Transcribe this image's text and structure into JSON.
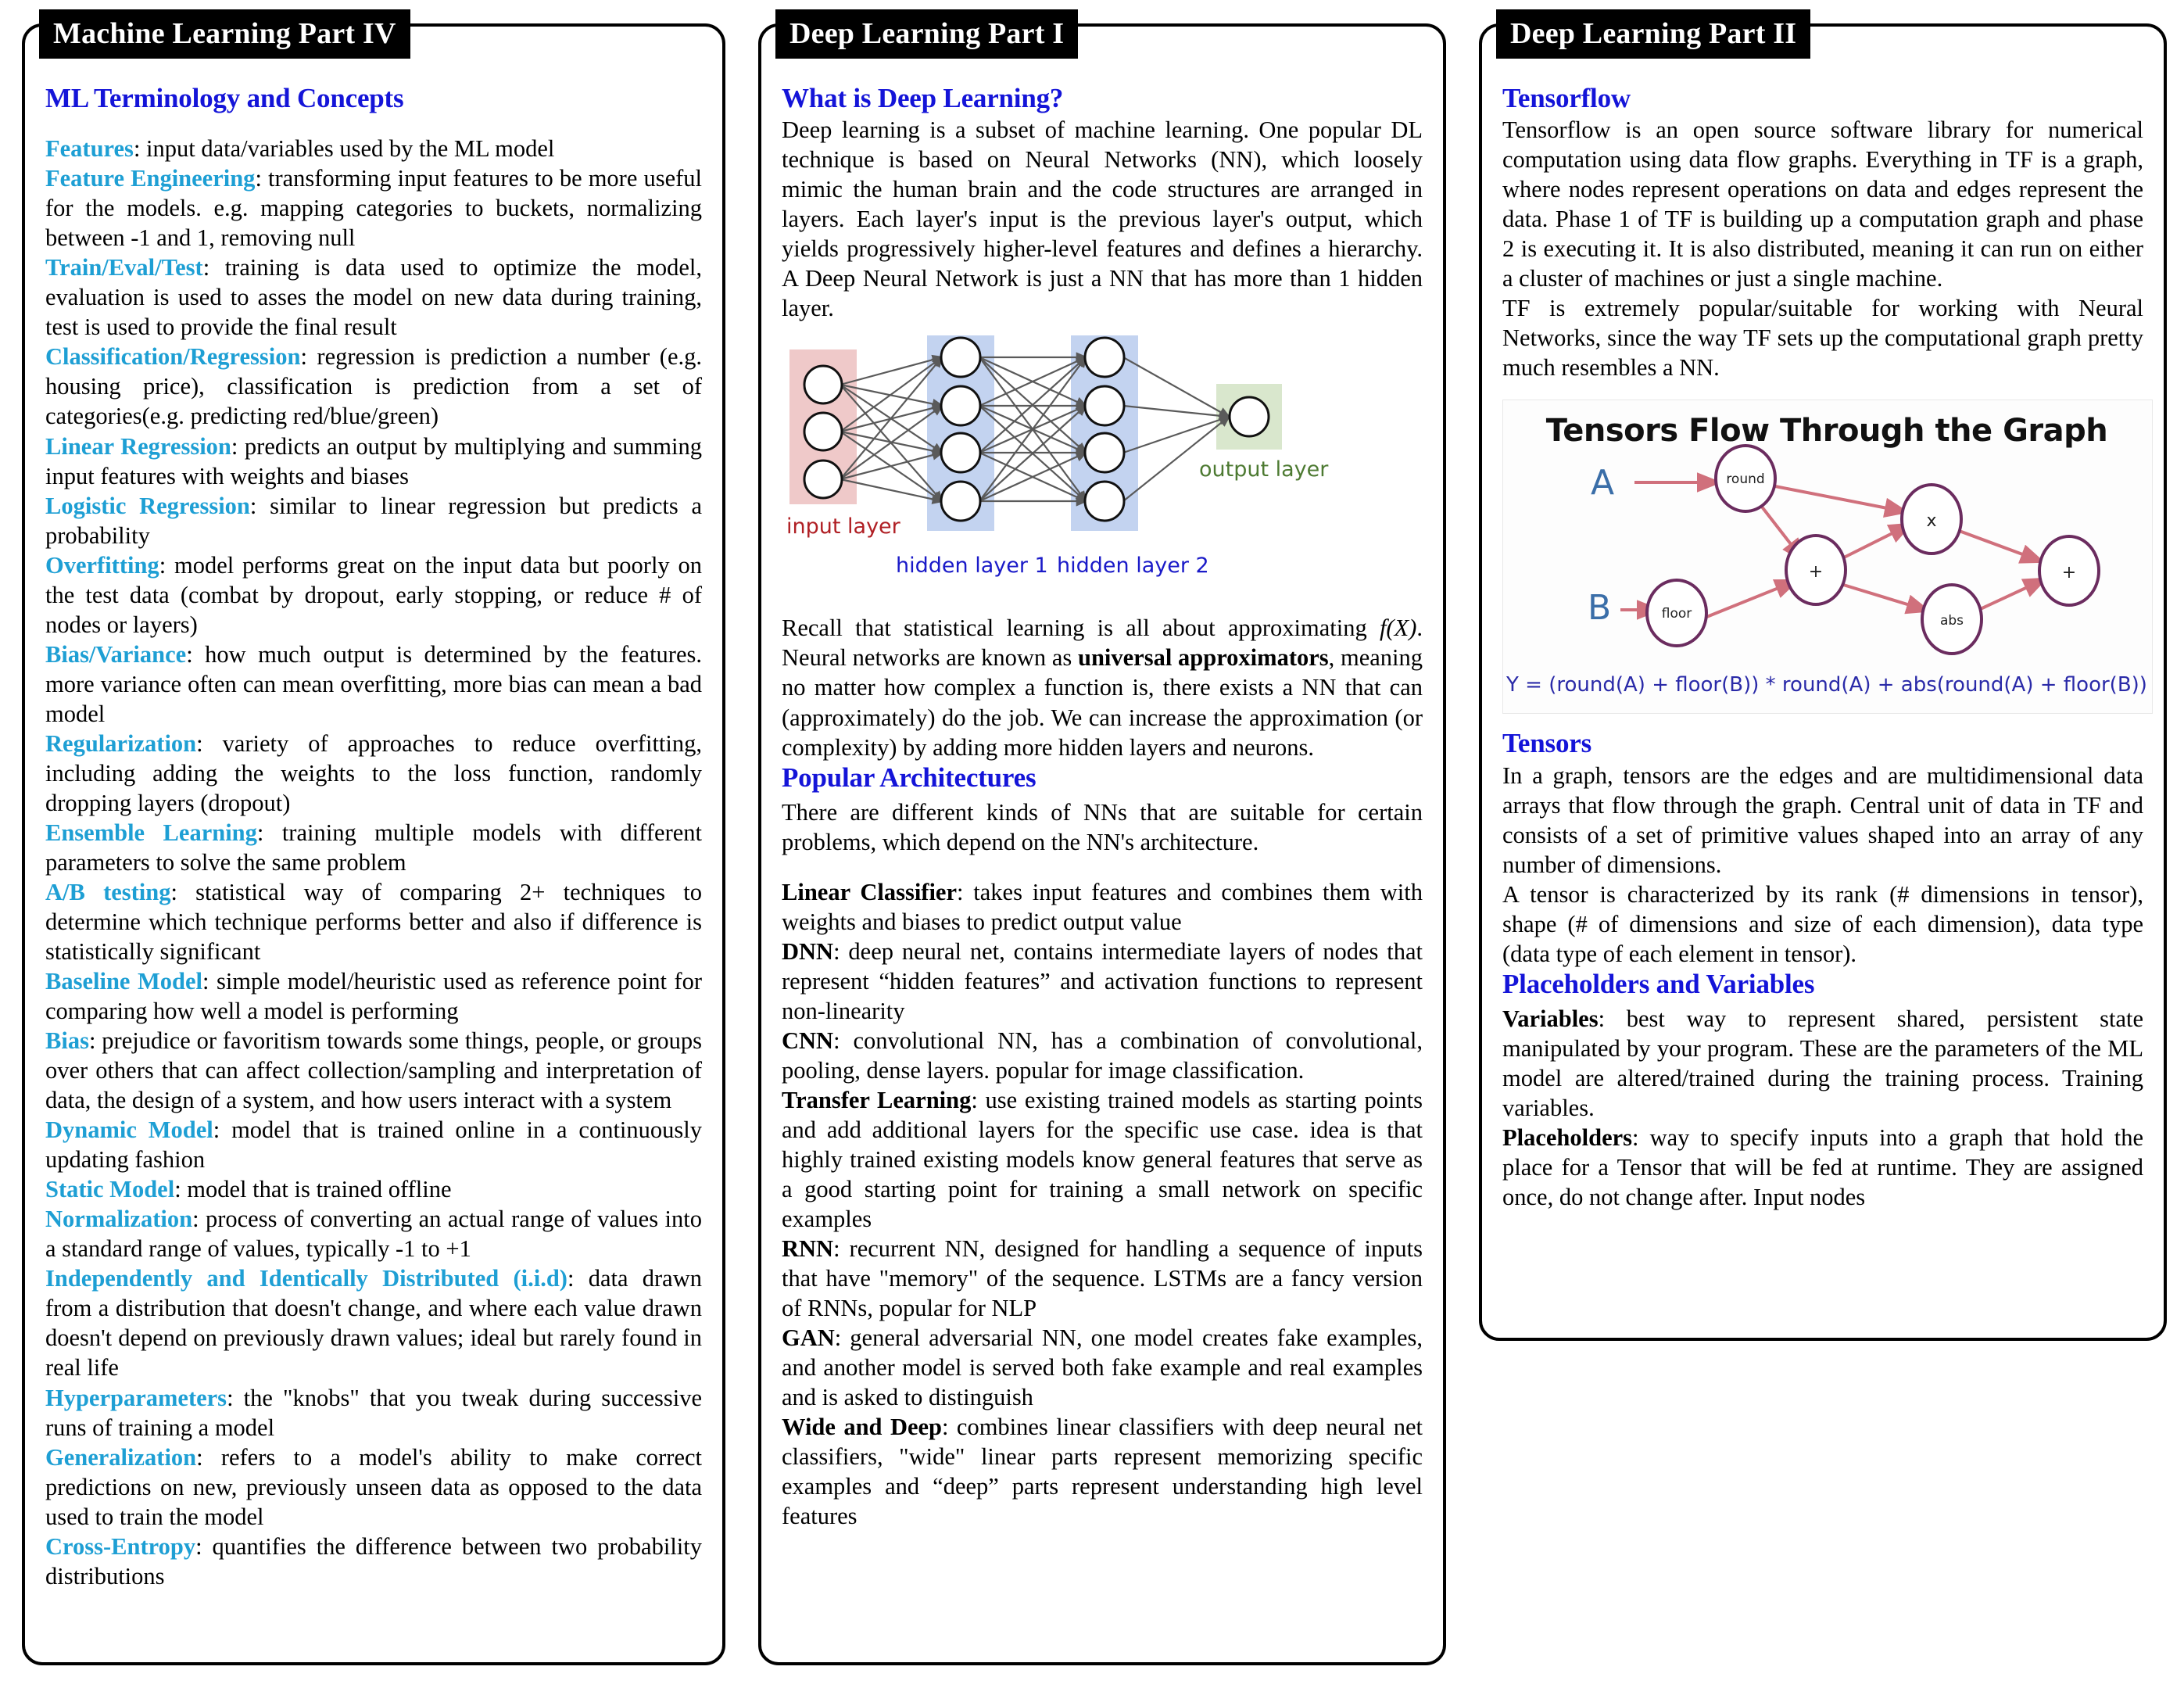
{
  "columns": [
    {
      "panel_title": "Machine Learning Part IV",
      "heading": "ML Terminology and Concepts",
      "terms": [
        {
          "term": "Features",
          "def": ": input data/variables used by the ML model"
        },
        {
          "term": "Feature Engineering",
          "def": ": transforming input features to be more useful for the models. e.g. mapping categories to buckets, normalizing between -1 and 1, removing null"
        },
        {
          "term": "Train/Eval/Test",
          "def": ": training is data used to optimize the model, evaluation is used to asses the model on new data during training, test is used to provide the final result"
        },
        {
          "term": "Classification/Regression",
          "def": ": regression is prediction a number (e.g. housing price), classification is prediction from a set of categories(e.g. predicting red/blue/green)"
        },
        {
          "term": "Linear Regression",
          "def": ": predicts an output by multiplying and summing input features with weights and biases"
        },
        {
          "term": "Logistic Regression",
          "def": ": similar to linear regression but predicts a probability"
        },
        {
          "term": "Overfitting",
          "def": ": model performs great on the input data but poorly on the test data (combat by dropout, early stopping, or reduce # of nodes or layers)"
        },
        {
          "term": "Bias/Variance",
          "def": ": how much output is determined by the features. more variance often can mean overfitting, more bias can mean a bad model"
        },
        {
          "term": "Regularization",
          "def": ": variety of approaches to reduce overfitting, including adding the weights to the loss function, randomly dropping layers (dropout)"
        },
        {
          "term": "Ensemble Learning",
          "def": ": training multiple models with different parameters to solve the same problem"
        },
        {
          "term": "A/B testing",
          "def": ": statistical way of comparing 2+ techniques to determine which technique performs better and also if difference is statistically significant"
        },
        {
          "term": "Baseline Model",
          "def": ": simple model/heuristic used as reference point for comparing how well a model is performing"
        },
        {
          "term": "Bias",
          "def": ": prejudice or favoritism towards some things, people, or groups over others that can affect collection/sampling and interpretation of data, the design of a system, and how users interact with a system"
        },
        {
          "term": "Dynamic Model",
          "def": ": model that is trained online in a continuously updating fashion"
        },
        {
          "term": "Static Model",
          "def": ": model that is trained offline"
        },
        {
          "term": "Normalization",
          "def": ": process of converting an actual range of values into a standard range of values, typically -1 to +1"
        },
        {
          "term": "Independently and Identically Distributed (i.i.d)",
          "def": ": data drawn from a distribution that doesn't change, and where each value drawn doesn't depend on previously drawn values; ideal but rarely found in real life"
        },
        {
          "term": "Hyperparameters",
          "def": ": the \"knobs\" that you tweak during successive runs of training a model"
        },
        {
          "term": "Generalization",
          "def": ": refers to a model's ability to make correct predictions on new, previously unseen data as opposed to the data used to train the model"
        },
        {
          "term": "Cross-Entropy",
          "def": ": quantifies the difference between two probability distributions"
        }
      ]
    },
    {
      "panel_title": "Deep Learning Part I",
      "heading1": "What is Deep Learning?",
      "para1": "Deep learning is a subset of machine learning. One popular DL technique is based on Neural Networks (NN), which loosely mimic the human brain and the code structures are arranged in layers. Each layer's input is the previous layer's output, which yields progressively higher-level features and defines a hierarchy. A Deep Neural Network is just a NN that has more than 1 hidden layer.",
      "para2_a": "Recall that statistical learning is all about approximating ",
      "para2_math": "f(X)",
      "para2_b": ". Neural networks are known as ",
      "para2_bold": "universal approximators",
      "para2_c": ", meaning no matter how complex a function is, there exists a NN that can (approximately) do the job. We can increase the approximation (or complexity) by adding more hidden layers and neurons.",
      "heading2": "Popular Architectures",
      "para3": "There are different kinds of NNs that are suitable for certain problems, which depend on the NN's architecture.",
      "terms": [
        {
          "term": "Linear Classifier",
          "def": ": takes input features and combines them with weights and biases to predict output value"
        },
        {
          "term": "DNN",
          "def": ": deep neural net, contains intermediate layers of nodes that represent “hidden features” and activation functions to represent non-linearity"
        },
        {
          "term": "CNN",
          "def": ": convolutional NN, has a combination of convolutional, pooling, dense layers. popular for image classification."
        },
        {
          "term": "Transfer Learning",
          "def": ": use existing trained models as starting points and add additional layers for the specific use case. idea is that highly trained existing models know general features that serve as a good starting point for training a small network on specific examples"
        },
        {
          "term": "RNN",
          "def": ": recurrent NN, designed for handling a sequence of inputs that have \"memory\" of the sequence. LSTMs are a fancy version of RNNs, popular for NLP"
        },
        {
          "term": "GAN",
          "def": ": general adversarial NN, one model creates fake examples, and another model is served both fake example and real examples and is asked to distinguish"
        },
        {
          "term": "Wide and Deep",
          "def": ": combines linear classifiers with deep neural net classifiers, \"wide\" linear parts represent memorizing specific examples and “deep” parts represent understanding high level features"
        }
      ],
      "nn_diagram": {
        "input_label": "input layer",
        "hidden1_label": "hidden layer 1",
        "hidden2_label": "hidden layer 2",
        "output_label": "output layer",
        "input_nodes": 3,
        "hidden1_nodes": 4,
        "hidden2_nodes": 4,
        "output_nodes": 1,
        "input_bg": "#efc9c9",
        "hidden_bg": "#c3d3f0",
        "output_bg": "#d9e7cd",
        "input_label_color": "#b01f24",
        "hidden_label_color": "#1a1ac8",
        "output_label_color": "#4d7a32",
        "edge_color": "#5a5a5a"
      }
    },
    {
      "panel_title": "Deep Learning Part II",
      "heading1": "Tensorflow",
      "para1": "Tensorflow is an open source software library for numerical computation using data flow graphs. Everything in TF is a graph, where nodes represent operations on data and edges represent the data. Phase 1 of TF is building up a computation graph and phase 2 is executing it. It is also distributed, meaning it can run on either a cluster of machines or just a single machine.",
      "para2": "TF is extremely popular/suitable for working with Neural Networks, since the way TF sets up the computational graph pretty much resembles a NN.",
      "heading2": "Tensors",
      "para3": "In a graph, tensors are the edges and are multidimensional data arrays that flow through the graph. Central unit of data in TF and consists of a set of primitive values shaped into an array of any number of dimensions.",
      "para4": "A tensor is characterized by its rank (# dimensions in tensor), shape (# of dimensions and size of each dimension), data type (data type of each element in tensor).",
      "heading3": "Placeholders and Variables",
      "terms": [
        {
          "term": "Variables",
          "def": ": best way to represent shared, persistent state manipulated by your program. These are the parameters of the ML model are altered/trained during the training process. Training variables."
        },
        {
          "term": "Placeholders",
          "def": ": way to specify inputs into a graph that hold the place for a Tensor that will be fed at runtime. They are assigned once, do not change after. Input nodes"
        }
      ],
      "tf_diagram": {
        "title": "Tensors Flow Through the Graph",
        "equation": "Y = (round(A) + floor(B)) * round(A) + abs(round(A) + floor(B))",
        "inputs": [
          "A",
          "B"
        ],
        "nodes": [
          "round",
          "floor",
          "+",
          "x",
          "abs",
          "+"
        ],
        "node_color": "#6b2c5f",
        "arrow_color": "#d0707c",
        "var_color": "#3a6ea8",
        "equation_color": "#2a2aa8"
      }
    }
  ]
}
